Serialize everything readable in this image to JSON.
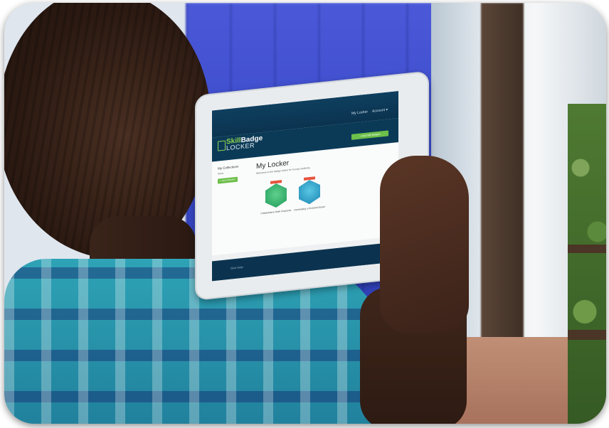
{
  "app": {
    "brand_skill": "Skill",
    "brand_badge": "Badge",
    "brand_locker": "LOCKER"
  },
  "nav": {
    "my_locker": "My Locker",
    "account": "Account ▾"
  },
  "header": {
    "add_badges_label": "+ Add Skill Badges"
  },
  "sidebar": {
    "title": "My Collections",
    "subtitle": "None",
    "add_button_label": "+ Add Collection"
  },
  "main": {
    "title": "My Locker",
    "subtitle": "Welcome to the badge locker for Kenya students."
  },
  "badges": [
    {
      "label": "Collaborative Work Character",
      "color": "#2aa866"
    },
    {
      "label": "Developing a Personal Brand",
      "color": "#2296c4"
    }
  ],
  "footer": {
    "text": "Give Help"
  },
  "colors": {
    "navy": "#0b3350",
    "green_accent": "#6cbf49"
  }
}
